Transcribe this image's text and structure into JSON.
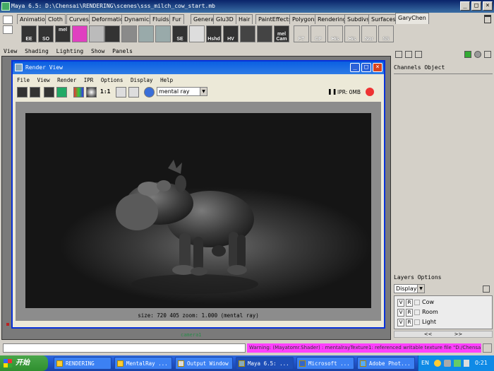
{
  "maya": {
    "title": "Maya 6.5: D:\\Chensai\\RENDERING\\scenes\\sss_milch_cow_start.mb",
    "shelf_tabs": [
      "Animation",
      "Cloth",
      "Curves",
      "Deformation",
      "Dynamics",
      "Fluids",
      "Fur",
      "General",
      "Glu3D",
      "Hair",
      "PaintEffects",
      "Polygons",
      "Rendering",
      "Subdivs",
      "Surfaces",
      "GaryChen"
    ],
    "active_shelf_tab": "GaryChen",
    "shelf_icon_labels": [
      "EE",
      "SO",
      "mel",
      "",
      "",
      "",
      "",
      "",
      "",
      "SE",
      "",
      "Hshd",
      "HV",
      "",
      "",
      "mel Cam",
      "FT",
      "CP",
      "His",
      "His",
      "Nor",
      "SS"
    ]
  },
  "viewport": {
    "menu": [
      "View",
      "Shading",
      "Lighting",
      "Show",
      "Panels"
    ],
    "camera_label": "camera1"
  },
  "channel_box": {
    "menu": [
      "Channels",
      "Object"
    ]
  },
  "layers": {
    "menu": [
      "Layers",
      "Options"
    ],
    "display_option": "Display",
    "items": [
      {
        "v": "V",
        "r": "R",
        "name": "Cow"
      },
      {
        "v": "V",
        "r": "R",
        "name": "Room"
      },
      {
        "v": "V",
        "r": "R",
        "name": "Light"
      }
    ]
  },
  "render_view": {
    "title": "Render View",
    "menu": [
      "File",
      "View",
      "Render",
      "IPR",
      "Options",
      "Display",
      "Help"
    ],
    "zoom_button": "1:1",
    "renderer": "mental ray",
    "ipr_label": "IPR: 0MB",
    "status": "size:  720  405 zoom: 1.000  (mental ray)"
  },
  "command_line": {
    "warning": "Warning: (Mayatomr.Shader) : mentalrayTexture1: referenced writable texture file \"D:/Chensai/RENDI"
  },
  "taskbar": {
    "start": "开始",
    "tasks": [
      "RENDERING",
      "MentalRay ...",
      "Output Window",
      "Maya 6.5: ...",
      "Microsoft ...",
      "Adobe Phot..."
    ],
    "active_task": 3,
    "language": "EN",
    "clock": "0:21"
  }
}
